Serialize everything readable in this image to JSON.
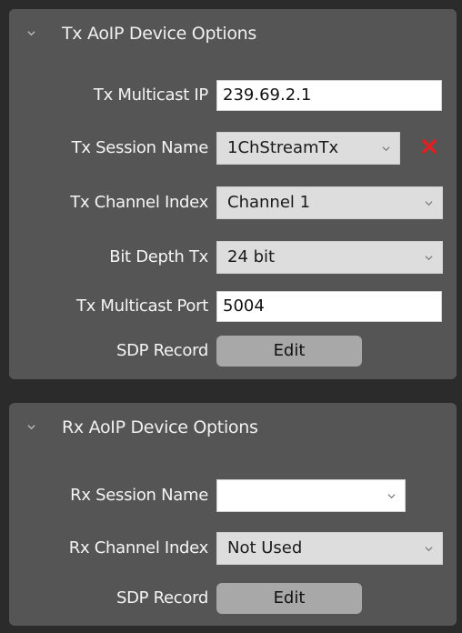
{
  "tx": {
    "title": "Tx AoIP Device Options",
    "multicast_ip_label": "Tx Multicast IP",
    "multicast_ip_value": "239.69.2.1",
    "session_name_label": "Tx Session Name",
    "session_name_value": "1ChStreamTx",
    "channel_index_label": "Tx Channel Index",
    "channel_index_value": "Channel 1",
    "bit_depth_label": "Bit Depth Tx",
    "bit_depth_value": "24 bit",
    "multicast_port_label": "Tx Multicast Port",
    "multicast_port_value": "5004",
    "sdp_label": "SDP Record",
    "sdp_button": "Edit"
  },
  "rx": {
    "title": "Rx AoIP Device Options",
    "session_name_label": "Rx Session Name",
    "session_name_value": "",
    "channel_index_label": "Rx Channel Index",
    "channel_index_value": "Not Used",
    "sdp_label": "SDP Record",
    "sdp_button": "Edit"
  },
  "icons": {
    "collapse": "chevron-down-icon",
    "dropdown": "chevron-down-icon",
    "remove": "close-icon"
  },
  "colors": {
    "panel_bg": "#555555",
    "page_bg": "#2b2b2b",
    "remove_icon": "#e02020",
    "button_bg": "#a8a8a8"
  }
}
